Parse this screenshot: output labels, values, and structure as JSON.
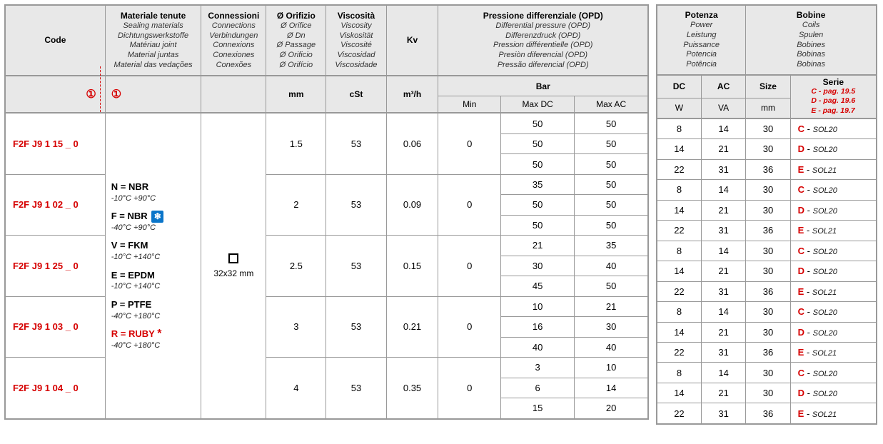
{
  "headers": {
    "code": "Code",
    "materials": {
      "main": "Materiale tenute",
      "subs": [
        "Sealing materials",
        "Dichtungswerkstoffe",
        "Matériau joint",
        "Material juntas",
        "Material das vedações"
      ]
    },
    "conn": {
      "main": "Connessioni",
      "subs": [
        "Connections",
        "Verbindungen",
        "Connexions",
        "Conexiones",
        "Conexões"
      ]
    },
    "orifice": {
      "main": "Ø Orifizio",
      "subs": [
        "Ø Orifice",
        "Ø Dn",
        "Ø Passage",
        "Ø Orificio",
        "Ø Orifício"
      ]
    },
    "visc": {
      "main": "Viscosità",
      "subs": [
        "Viscosity",
        "Viskosität",
        "Viscosité",
        "Viscosidad",
        "Viscosidade"
      ]
    },
    "kv": "Kv",
    "opd": {
      "main": "Pressione differenziale (OPD)",
      "subs": [
        "Differential pressure (OPD)",
        "Differenzdruck (OPD)",
        "Pression différentielle (OPD)",
        "Presiòn diferencial (OPD)",
        "Pressão diferencial (OPD)"
      ]
    },
    "power": {
      "main": "Potenza",
      "subs": [
        "Power",
        "Leistung",
        "Puissance",
        "Potencia",
        "Potência"
      ]
    },
    "coils": {
      "main": "Bobine",
      "subs": [
        "Coils",
        "Spulen",
        "Bobines",
        "Bobinas",
        "Bobinas"
      ]
    },
    "mm": "mm",
    "cst": "cSt",
    "m3h": "m³/h",
    "bar": "Bar",
    "min": "Min",
    "maxdc": "Max DC",
    "maxac": "Max AC",
    "dc": "DC",
    "ac": "AC",
    "size": "Size",
    "serie": "Serie",
    "w": "W",
    "va": "VA",
    "mm2": "mm",
    "serie_notes": [
      "C - pag. 19.5",
      "D - pag. 19.6",
      "E - pag. 19.7"
    ]
  },
  "note1": "①",
  "materials": [
    {
      "letter": "N",
      "name": "NBR",
      "temp": "-10°C   +90°C",
      "snow": false
    },
    {
      "letter": "F",
      "name": "NBR",
      "temp": "-40°C   +90°C",
      "snow": true
    },
    {
      "letter": "V",
      "name": "FKM",
      "temp": "-10°C   +140°C",
      "snow": false
    },
    {
      "letter": "E",
      "name": "EPDM",
      "temp": "-10°C   +140°C",
      "snow": false
    },
    {
      "letter": "P",
      "name": "PTFE",
      "temp": "-40°C   +180°C",
      "snow": false
    },
    {
      "letter": "R",
      "name": "RUBY",
      "temp": "-40°C   +180°C",
      "snow": false,
      "ruby": true
    }
  ],
  "conn": "32x32 mm",
  "rows": [
    {
      "code": "F2F J9 1 15 _ 0",
      "mm": "1.5",
      "cst": "53",
      "kv": "0.06",
      "min": "0",
      "p": [
        [
          "50",
          "50"
        ],
        [
          "50",
          "50"
        ],
        [
          "50",
          "50"
        ]
      ]
    },
    {
      "code": "F2F J9 1 02 _ 0",
      "mm": "2",
      "cst": "53",
      "kv": "0.09",
      "min": "0",
      "p": [
        [
          "35",
          "50"
        ],
        [
          "50",
          "50"
        ],
        [
          "50",
          "50"
        ]
      ]
    },
    {
      "code": "F2F J9 1 25 _ 0",
      "mm": "2.5",
      "cst": "53",
      "kv": "0.15",
      "min": "0",
      "p": [
        [
          "21",
          "35"
        ],
        [
          "30",
          "40"
        ],
        [
          "45",
          "50"
        ]
      ]
    },
    {
      "code": "F2F J9 1 03 _ 0",
      "mm": "3",
      "cst": "53",
      "kv": "0.21",
      "min": "0",
      "p": [
        [
          "10",
          "21"
        ],
        [
          "16",
          "30"
        ],
        [
          "40",
          "40"
        ]
      ]
    },
    {
      "code": "F2F J9 1 04 _ 0",
      "mm": "4",
      "cst": "53",
      "kv": "0.35",
      "min": "0",
      "p": [
        [
          "3",
          "10"
        ],
        [
          "6",
          "14"
        ],
        [
          "15",
          "20"
        ]
      ]
    }
  ],
  "right_rows": [
    {
      "w": "8",
      "va": "14",
      "size": "30",
      "serie": "C",
      "sol": "SOL20"
    },
    {
      "w": "14",
      "va": "21",
      "size": "30",
      "serie": "D",
      "sol": "SOL20"
    },
    {
      "w": "22",
      "va": "31",
      "size": "36",
      "serie": "E",
      "sol": "SOL21"
    }
  ]
}
